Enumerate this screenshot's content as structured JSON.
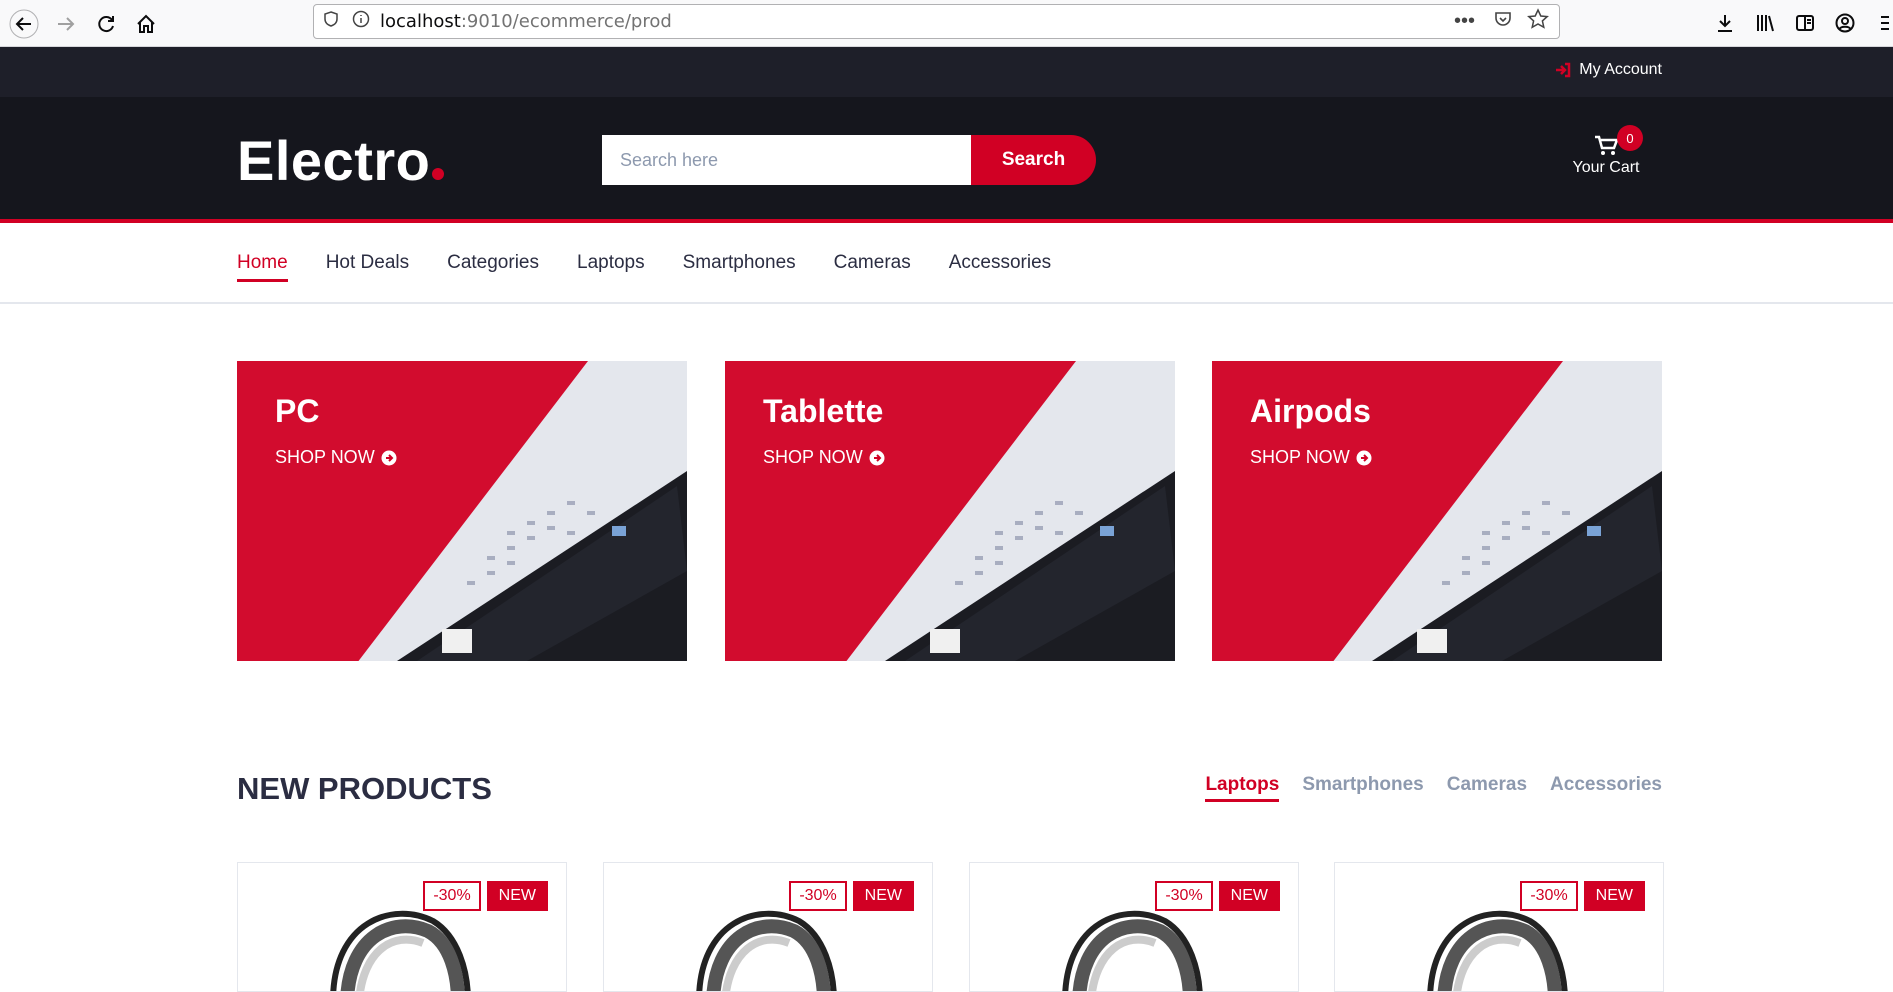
{
  "browser": {
    "url_host": "localhost",
    "url_rest": ":9010/ecommerce/prod"
  },
  "top_header": {
    "account_label": "My Account"
  },
  "header": {
    "logo": "Electro",
    "search_placeholder": "Search here",
    "search_button": "Search",
    "cart_label": "Your Cart",
    "cart_count": "0"
  },
  "nav": {
    "items": [
      "Home",
      "Hot Deals",
      "Categories",
      "Laptops",
      "Smartphones",
      "Cameras",
      "Accessories"
    ],
    "active": "Home"
  },
  "banners": [
    {
      "title": "PC",
      "cta": "SHOP NOW"
    },
    {
      "title": "Tablette",
      "cta": "SHOP NOW"
    },
    {
      "title": "Airpods",
      "cta": "SHOP NOW"
    }
  ],
  "new_products": {
    "title": "NEW PRODUCTS",
    "tabs": [
      "Laptops",
      "Smartphones",
      "Cameras",
      "Accessories"
    ],
    "active_tab": "Laptops",
    "items": [
      {
        "sale": "-30%",
        "badge": "NEW"
      },
      {
        "sale": "-30%",
        "badge": "NEW"
      },
      {
        "sale": "-30%",
        "badge": "NEW"
      },
      {
        "sale": "-30%",
        "badge": "NEW"
      }
    ]
  },
  "colors": {
    "brand_red": "#d10024",
    "header_dark": "#15161d",
    "top_header": "#1e1f29",
    "muted": "#8d99ae"
  }
}
